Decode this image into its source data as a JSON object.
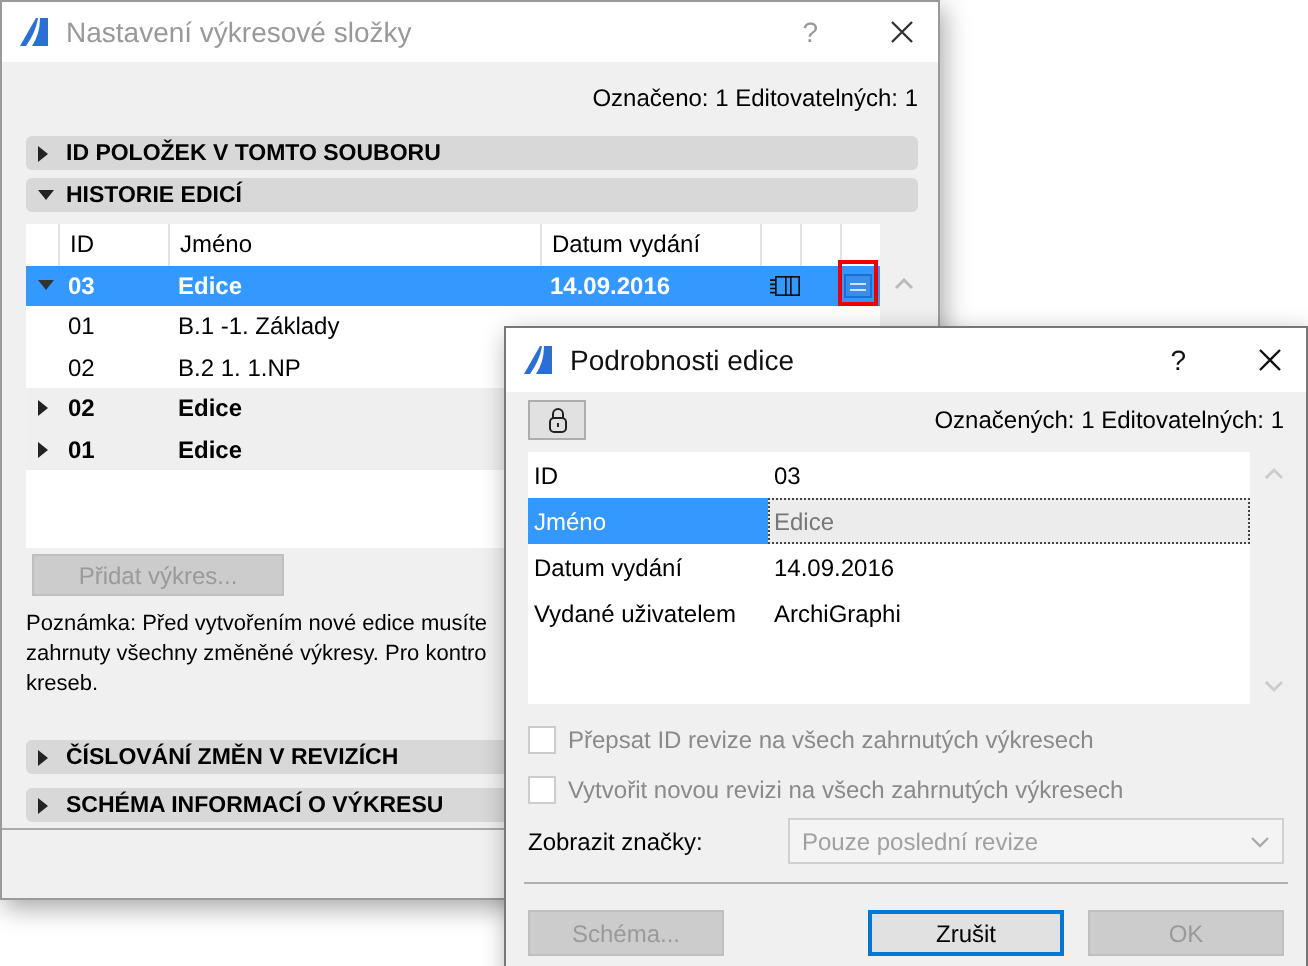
{
  "main_window": {
    "title": "Nastavení výkresové složky",
    "help": "?",
    "counts": "Označeno: 1 Editovatelných: 1",
    "sections": [
      {
        "label": "ID POLOŽEK V TOMTO SOUBORU",
        "expanded": false
      },
      {
        "label": "HISTORIE EDICÍ",
        "expanded": true
      }
    ],
    "table": {
      "columns": [
        "ID",
        "Jméno",
        "Datum vydání"
      ],
      "rows": [
        {
          "kind": "issue",
          "id": "03",
          "name": "Edice",
          "date": "14.09.2016",
          "expanded": true,
          "selected": true,
          "highlighted": true
        },
        {
          "kind": "sheet",
          "id": "01",
          "name": "B.1 -1. Základy",
          "selected": false
        },
        {
          "kind": "sheet",
          "id": "02",
          "name": "B.2 1. 1.NP",
          "selected": false
        },
        {
          "kind": "issue",
          "id": "02",
          "name": "Edice",
          "expanded": false,
          "selected": false
        },
        {
          "kind": "issue",
          "id": "01",
          "name": "Edice",
          "expanded": false,
          "selected": false
        }
      ]
    },
    "add_button": {
      "label": "Přidat výkres...",
      "disabled": true
    },
    "note": [
      "Poznámka: Před vytvořením nové edice musíte",
      "zahrnuty všechny změněné výkresy. Pro kontro",
      "kreseb."
    ],
    "lower_sections": [
      {
        "label": "ČÍSLOVÁNÍ ZMĚN V REVIZÍCH",
        "expanded": false
      },
      {
        "label": "SCHÉMA INFORMACÍ O VÝKRESU",
        "expanded": false
      }
    ]
  },
  "dialog": {
    "title": "Podrobnosti edice",
    "help": "?",
    "counts": "Označených: 1 Editovatelných: 1",
    "properties": [
      {
        "label": "ID",
        "value": "03",
        "selected": false
      },
      {
        "label": "Jméno",
        "value": "Edice",
        "selected": true
      },
      {
        "label": "Datum vydání",
        "value": "14.09.2016",
        "selected": false
      },
      {
        "label": "Vydané uživatelem",
        "value": "ArchiGraphi",
        "selected": false
      }
    ],
    "options": [
      {
        "label": "Přepsat ID revize na všech zahrnutých výkresech",
        "checked": false,
        "disabled": true
      },
      {
        "label": "Vytvořit novou revizi na všech zahrnutých výkresech",
        "checked": false,
        "disabled": true
      }
    ],
    "marker_label": "Zobrazit značky:",
    "marker_select": {
      "value": "Pouze poslední revize",
      "disabled": true
    },
    "buttons": [
      {
        "label": "Schéma...",
        "disabled": true,
        "default": false
      },
      {
        "label": "Zrušit",
        "disabled": false,
        "default": true
      },
      {
        "label": "OK",
        "disabled": true,
        "default": false
      }
    ]
  }
}
